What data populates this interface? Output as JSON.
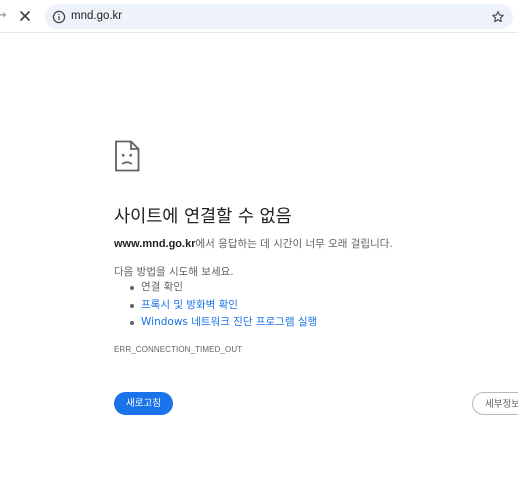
{
  "browser": {
    "url": "mnd.go.kr",
    "icons": {
      "forward": "forward-arrow-icon",
      "stop": "close-icon",
      "site_info": "info-icon",
      "bookmark": "star-icon"
    }
  },
  "error": {
    "icon": "sad-page-icon",
    "title": "사이트에 연결할 수 없음",
    "host": "www.mnd.go.kr",
    "message": "에서 응답하는 데 시간이 너무 오래 걸립니다.",
    "suggestions_heading": "다음 방법을 시도해 보세요.",
    "suggestions": [
      {
        "label": "연결 확인",
        "link": false
      },
      {
        "label": "프록시 및 방화벽 확인",
        "link": true
      },
      {
        "label": "Windows 네트워크 진단 프로그램 실행",
        "link": true
      }
    ],
    "code": "ERR_CONNECTION_TIMED_OUT",
    "reload_label": "새로고침",
    "details_label": "세부정보"
  },
  "colors": {
    "accent": "#1a73e8",
    "text": "#202124",
    "secondary_text": "#5f6368",
    "omnibox_bg": "#eef2f9"
  }
}
